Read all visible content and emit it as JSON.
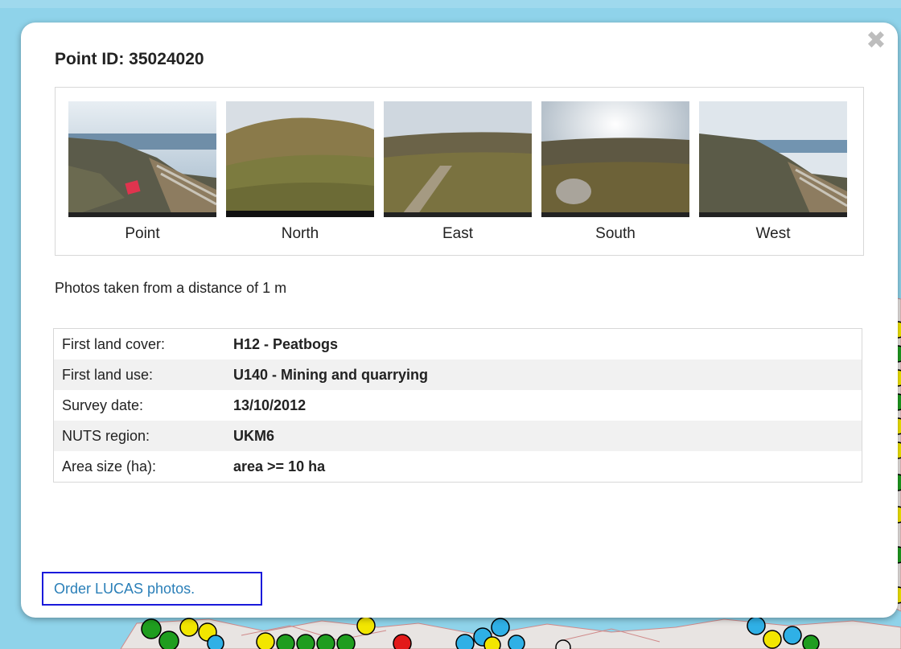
{
  "popup": {
    "title": "Point ID: 35024020",
    "close_symbol": "✖",
    "photos": [
      {
        "label": "Point"
      },
      {
        "label": "North"
      },
      {
        "label": "East"
      },
      {
        "label": "South"
      },
      {
        "label": "West"
      }
    ],
    "distance_text": "Photos taken from a distance of 1 m",
    "attributes": [
      {
        "key": "First land cover:",
        "value": "H12 - Peatbogs"
      },
      {
        "key": "First land use:",
        "value": "U140 - Mining and quarrying"
      },
      {
        "key": "Survey date:",
        "value": "13/10/2012"
      },
      {
        "key": "NUTS region:",
        "value": "UKM6"
      },
      {
        "key": "Area size (ha):",
        "value": "area >= 10 ha"
      }
    ],
    "order_link": "Order LUCAS photos."
  },
  "colors": {
    "map_water": "#8fd3ea",
    "link": "#2a7fb8",
    "highlight_border": "#1a1adb"
  }
}
